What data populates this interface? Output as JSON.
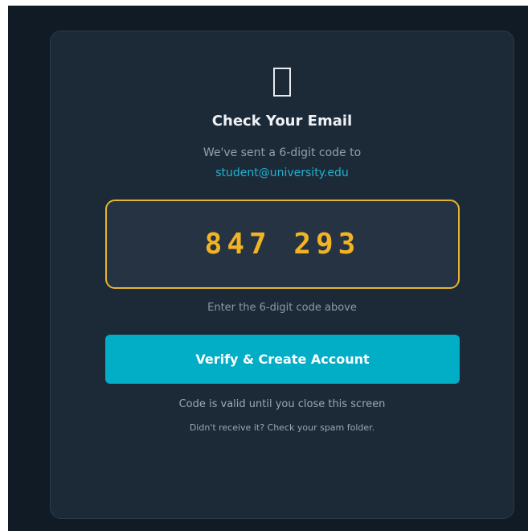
{
  "verify_screen": {
    "icon": "envelope-icon",
    "title": "Check Your Email",
    "subtitle": "We've sent a 6-digit code to",
    "email": "student@university.edu",
    "code": "847 293",
    "hint": "Enter the 6-digit code above",
    "button_label": "Verify & Create Account",
    "valid_note": "Code is valid until you close this screen",
    "spam_note": "Didn't receive it? Check your spam folder."
  },
  "colors": {
    "background": "#111b26",
    "card": "#1c2a38",
    "accent": "#02adc6",
    "code": "#f2b424",
    "email_link": "#21b3cf"
  }
}
